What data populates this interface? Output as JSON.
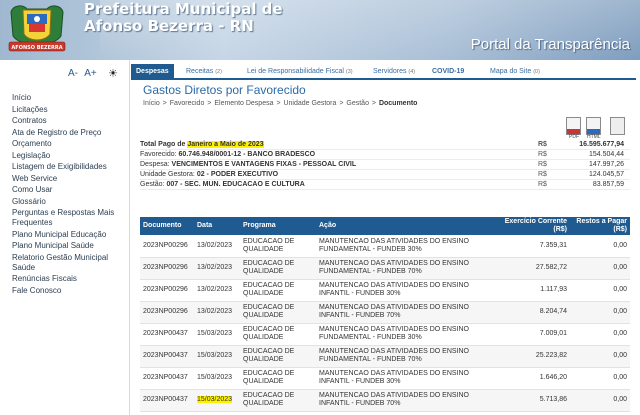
{
  "header": {
    "title_line1": "Prefeitura Municipal de",
    "title_line2": "Afonso Bezerra - RN",
    "portal": "Portal da Transparência",
    "logo_text": "AFONSO BEZERRA"
  },
  "sidebar": {
    "font_decrease": "A-",
    "font_increase": "A+",
    "items": [
      "Início",
      "Licitações",
      "Contratos",
      "Ata de Registro de Preço",
      "Orçamento",
      "Legislação",
      "Listagem de Exigibilidades",
      "Web Service",
      "Como Usar",
      "Glossário",
      "Perguntas e Respostas Mais Frequentes",
      "Plano Municipal Educação",
      "Plano Municipal Saúde",
      "Relatorio Gestão Municipal Saúde",
      "Renúncias Fiscais",
      "Fale Conosco"
    ]
  },
  "tabs": [
    {
      "label": "Despesas",
      "count": ""
    },
    {
      "label": "Receitas",
      "count": "(2)"
    },
    {
      "label": "Lei de Responsabilidade Fiscal",
      "count": "(3)"
    },
    {
      "label": "Servidores",
      "count": "(4)"
    },
    {
      "label": "COVID-19",
      "count": ""
    },
    {
      "label": "Mapa do Site",
      "count": "(0)"
    }
  ],
  "page": {
    "title": "Gastos Diretos por Favorecido",
    "breadcrumb": [
      "Início",
      "Favorecido",
      "Elemento Despesa",
      "Unidade Gestora",
      "Gestão"
    ],
    "breadcrumb_current": "Documento",
    "export_pdf": "PDF",
    "export_html": "HTML"
  },
  "summary": {
    "total_label": "Total Pago de ",
    "total_period": "Janeiro a Maio de 2023",
    "total_currency": "R$",
    "total_value": "16.595.677,94",
    "rows": [
      {
        "label": "Favorecido:",
        "value": "60.746.948/0001-12 - BANCO BRADESCO",
        "currency": "R$",
        "amount": "154.504,44"
      },
      {
        "label": "Despesa:",
        "value": "VENCIMENTOS E VANTAGENS FIXAS - PESSOAL CIVIL",
        "currency": "R$",
        "amount": "147.997,26"
      },
      {
        "label": "Unidade Gestora:",
        "value": "02 - PODER EXECUTIVO",
        "currency": "R$",
        "amount": "124.045,57"
      },
      {
        "label": "Gestão:",
        "value": "007 - SEC. MUN. EDUCACAO E CULTURA",
        "currency": "R$",
        "amount": "83.857,59"
      }
    ]
  },
  "table": {
    "headers": [
      "Documento",
      "Data",
      "Programa",
      "Ação",
      "Exercício Corrente (R$)",
      "Restos a Pagar (R$)"
    ],
    "rows": [
      {
        "doc": "2023NP00296",
        "date": "13/02/2023",
        "prog": "EDUCACAO DE QUALIDADE",
        "acao": "MANUTENCAO DAS ATIVIDADES DO ENSINO FUNDAMENTAL - FUNDEB 30%",
        "corrente": "7.359,31",
        "restos": "0,00"
      },
      {
        "doc": "2023NP00296",
        "date": "13/02/2023",
        "prog": "EDUCACAO DE QUALIDADE",
        "acao": "MANUTENCAO DAS ATIVIDADES DO ENSINO FUNDAMENTAL - FUNDEB 70%",
        "corrente": "27.582,72",
        "restos": "0,00"
      },
      {
        "doc": "2023NP00296",
        "date": "13/02/2023",
        "prog": "EDUCACAO DE QUALIDADE",
        "acao": "MANUTENCAO DAS ATIVIDADES DO ENSINO INFANTIL - FUNDEB 30%",
        "corrente": "1.117,93",
        "restos": "0,00"
      },
      {
        "doc": "2023NP00296",
        "date": "13/02/2023",
        "prog": "EDUCACAO DE QUALIDADE",
        "acao": "MANUTENCAO DAS ATIVIDADES DO ENSINO INFANTIL - FUNDEB 70%",
        "corrente": "8.204,74",
        "restos": "0,00"
      },
      {
        "doc": "2023NP00437",
        "date": "15/03/2023",
        "prog": "EDUCACAO DE QUALIDADE",
        "acao": "MANUTENCAO DAS ATIVIDADES DO ENSINO FUNDAMENTAL - FUNDEB 30%",
        "corrente": "7.009,01",
        "restos": "0,00"
      },
      {
        "doc": "2023NP00437",
        "date": "15/03/2023",
        "prog": "EDUCACAO DE QUALIDADE",
        "acao": "MANUTENCAO DAS ATIVIDADES DO ENSINO FUNDAMENTAL - FUNDEB 70%",
        "corrente": "25.223,82",
        "restos": "0,00"
      },
      {
        "doc": "2023NP00437",
        "date": "15/03/2023",
        "prog": "EDUCACAO DE QUALIDADE",
        "acao": "MANUTENCAO DAS ATIVIDADES DO ENSINO INFANTIL - FUNDEB 30%",
        "corrente": "1.646,20",
        "restos": "0,00"
      },
      {
        "doc": "2023NP00437",
        "date": "15/03/2023",
        "prog": "EDUCACAO DE QUALIDADE",
        "acao": "MANUTENCAO DAS ATIVIDADES DO ENSINO INFANTIL - FUNDEB 70%",
        "corrente": "5.713,86",
        "restos": "0,00"
      }
    ]
  },
  "colors": {
    "primary": "#1f5b91",
    "link": "#3b6ea3",
    "highlight": "#fff200",
    "header_sky": "#a9bfd6"
  }
}
